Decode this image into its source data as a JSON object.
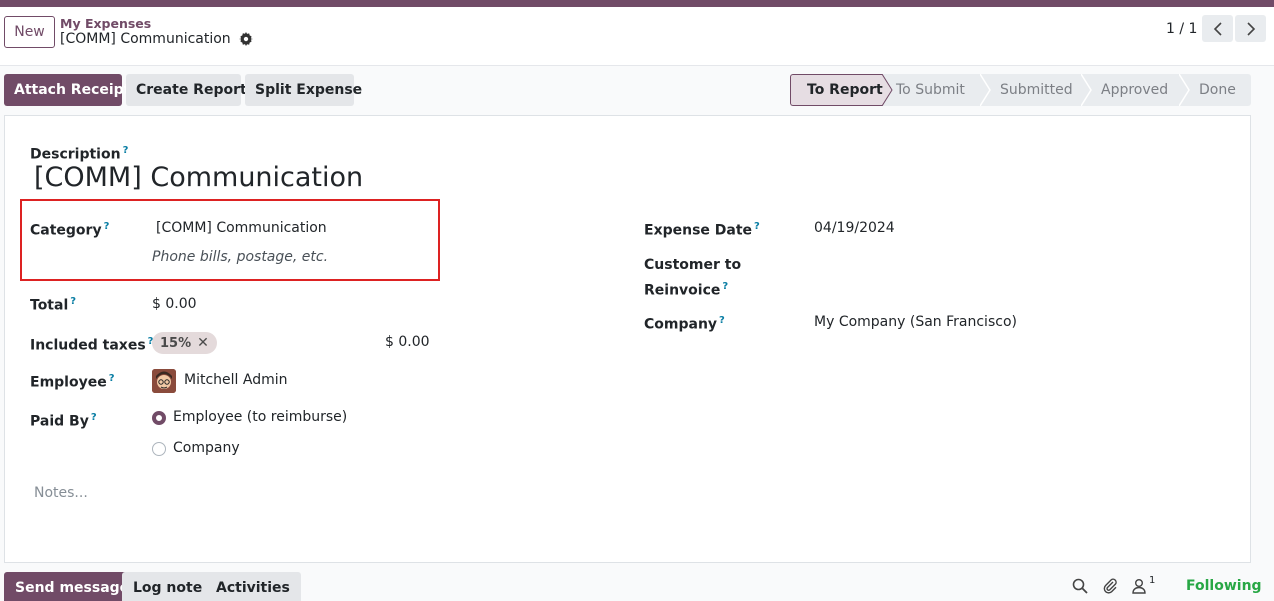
{
  "header": {
    "new_label": "New",
    "breadcrumb_parent": "My Expenses",
    "breadcrumb_current": "[COMM] Communication",
    "pager": "1 / 1"
  },
  "actions": {
    "attach_receipt": "Attach Receipt",
    "create_report": "Create Report",
    "split_expense": "Split Expense"
  },
  "status_stages": [
    {
      "label": "To Report",
      "active": true
    },
    {
      "label": "To Submit",
      "active": false
    },
    {
      "label": "Submitted",
      "active": false
    },
    {
      "label": "Approved",
      "active": false
    },
    {
      "label": "Done",
      "active": false
    }
  ],
  "form": {
    "description_label": "Description",
    "description_value": "[COMM] Communication",
    "category_label": "Category",
    "category_value": "[COMM] Communication",
    "category_hint": "Phone bills, postage, etc.",
    "total_label": "Total",
    "total_value": "$ 0.00",
    "taxes_label": "Included taxes",
    "tax_tag": "15%",
    "tax_amount": "$ 0.00",
    "employee_label": "Employee",
    "employee_value": "Mitchell Admin",
    "paid_by_label": "Paid By",
    "paid_by_options": [
      {
        "label": "Employee (to reimburse)",
        "checked": true
      },
      {
        "label": "Company",
        "checked": false
      }
    ],
    "expense_date_label": "Expense Date",
    "expense_date_value": "04/19/2024",
    "customer_reinvoice_label_1": "Customer to",
    "customer_reinvoice_label_2": "Reinvoice",
    "company_label": "Company",
    "company_value": "My Company (San Francisco)",
    "help_mark": "?",
    "notes_placeholder": "Notes..."
  },
  "chatter": {
    "send_message": "Send message",
    "log_note": "Log note",
    "activities": "Activities",
    "follower_count": "1",
    "following": "Following"
  },
  "colors": {
    "brand": "#714b67",
    "following": "#28a745",
    "highlight_border": "#dd2222"
  }
}
